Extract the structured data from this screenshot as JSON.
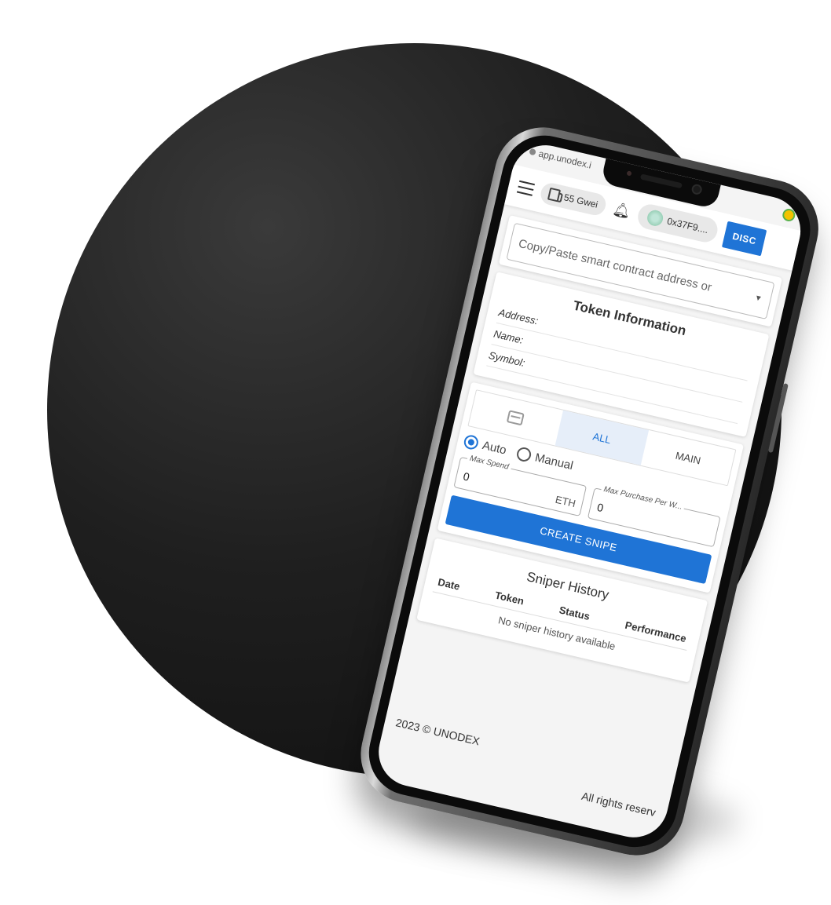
{
  "browser": {
    "url": "app.unodex.i"
  },
  "header": {
    "gas_label": "55 Gwei",
    "wallet_address": "0x37F9....",
    "disconnect_label": "DISC"
  },
  "contract_input": {
    "placeholder": "Copy/Paste smart contract address or"
  },
  "token_info": {
    "title": "Token Information",
    "rows": [
      "Address:",
      "Name:",
      "Symbol:"
    ]
  },
  "snipe": {
    "tabs": [
      "",
      "ALL",
      "MAIN"
    ],
    "active_tab": "ALL",
    "mode_auto": "Auto",
    "mode_manual": "Manual",
    "selected_mode": "Auto",
    "max_spend_label": "Max Spend",
    "max_spend_value": "0",
    "max_spend_unit": "ETH",
    "max_purchase_label": "Max Purchase Per W...",
    "max_purchase_value": "0",
    "create_label": "CREATE SNIPE"
  },
  "history": {
    "title": "Sniper History",
    "columns": [
      "Date",
      "Token",
      "Status",
      "Performance"
    ],
    "empty_text": "No sniper history available"
  },
  "footer": {
    "copyright": "2023 © UNODEX",
    "rights": "All rights reserv"
  },
  "colors": {
    "accent": "#1f74d6",
    "backdrop": "#1a1a1a"
  }
}
